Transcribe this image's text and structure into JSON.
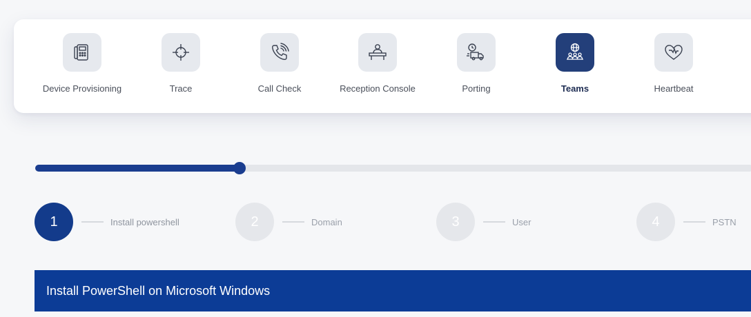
{
  "tools": [
    {
      "label": "Device Provisioning",
      "icon": "desk-phone-icon",
      "active": false
    },
    {
      "label": "Trace",
      "icon": "crosshair-icon",
      "active": false
    },
    {
      "label": "Call Check",
      "icon": "phone-ringing-icon",
      "active": false
    },
    {
      "label": "Reception Console",
      "icon": "reception-desk-icon",
      "active": false
    },
    {
      "label": "Porting",
      "icon": "delivery-truck-icon",
      "active": false
    },
    {
      "label": "Teams",
      "icon": "team-globe-icon",
      "active": true
    },
    {
      "label": "Heartbeat",
      "icon": "heart-pulse-icon",
      "active": false
    }
  ],
  "progress": {
    "value_percent": 28.5,
    "color": "#1a3d8f"
  },
  "steps": [
    {
      "number": "1",
      "label": "Install powershell",
      "active": true
    },
    {
      "number": "2",
      "label": "Domain",
      "active": false
    },
    {
      "number": "3",
      "label": "User",
      "active": false
    },
    {
      "number": "4",
      "label": "PSTN",
      "active": false
    }
  ],
  "section": {
    "title": "Install PowerShell on Microsoft Windows"
  },
  "colors": {
    "primary": "#0c3c96",
    "active_tile": "#233f7a",
    "inactive_step": "#e5e7eb"
  }
}
